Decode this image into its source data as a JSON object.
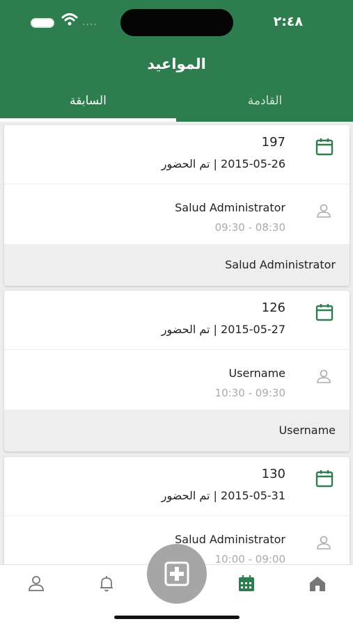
{
  "status": {
    "time": "٢:٤٨",
    "signal_dots": "...."
  },
  "header": {
    "title": "المواعيد"
  },
  "tabs": [
    {
      "label": "السابقة",
      "active": true
    },
    {
      "label": "القادمة",
      "active": false
    }
  ],
  "appointments": [
    {
      "id": "197",
      "date_status": "2015-05-26 | تم الحضور",
      "doctor": "Salud Administrator",
      "time": "09:30 - 08:30",
      "footer_name": "Salud Administrator"
    },
    {
      "id": "126",
      "date_status": "2015-05-27 | تم الحضور",
      "doctor": "Username",
      "time": "10:30 - 09:30",
      "footer_name": "Username"
    },
    {
      "id": "130",
      "date_status": "2015-05-31 | تم الحضور",
      "doctor": "Salud Administrator",
      "time": "10:00 - 09:00",
      "footer_name": ""
    }
  ],
  "nav": {
    "items": [
      "profile-icon",
      "bell-icon",
      "add-appointment-icon",
      "calendar-icon",
      "home-icon"
    ],
    "active": "calendar-icon"
  },
  "colors": {
    "primary": "#2e7d4f",
    "fab": "#a6a6a6",
    "muted": "#aaaaaa"
  }
}
